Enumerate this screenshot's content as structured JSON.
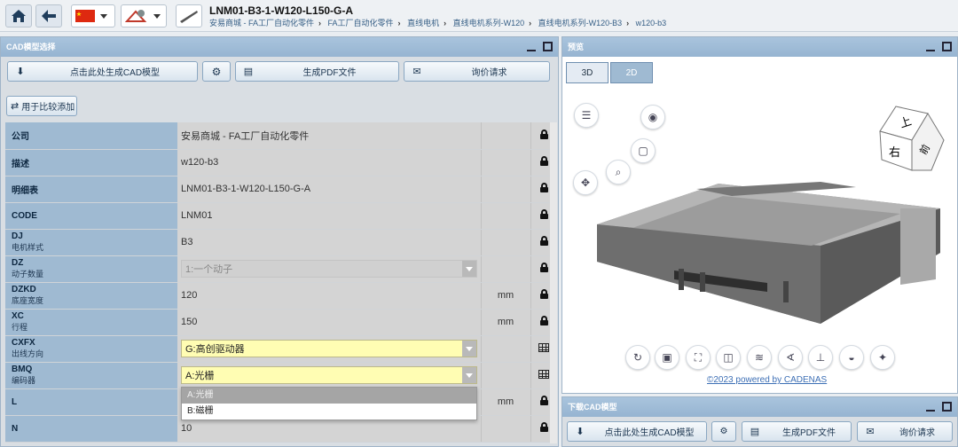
{
  "header": {
    "title": "LNM01-B3-1-W120-L150-G-A",
    "breadcrumbs": [
      "安易商城 - FA工厂自动化零件",
      "FA工厂自动化零件",
      "直线电机",
      "直线电机系列-W120",
      "直线电机系列-W120-B3",
      "w120-b3"
    ]
  },
  "left_panel": {
    "title": "CAD模型选择",
    "buttons": {
      "generate_cad": "点击此处生成CAD模型",
      "generate_pdf": "生成PDF文件",
      "inquiry": "询价请求",
      "compare": "用于比较添加"
    },
    "rows": [
      {
        "key": "公司",
        "sub": "",
        "value": "安易商城 - FA工厂自动化零件",
        "unit": "",
        "kind": "text",
        "icon": "lock"
      },
      {
        "key": "描述",
        "sub": "",
        "value": "w120-b3",
        "unit": "",
        "kind": "text",
        "icon": "lock"
      },
      {
        "key": "明细表",
        "sub": "",
        "value": "LNM01-B3-1-W120-L150-G-A",
        "unit": "",
        "kind": "text",
        "icon": "lock"
      },
      {
        "key": "CODE",
        "sub": "",
        "value": "LNM01",
        "unit": "",
        "kind": "text",
        "icon": "lock"
      },
      {
        "key": "DJ",
        "sub": "电机样式",
        "value": "B3",
        "unit": "",
        "kind": "text",
        "icon": "lock"
      },
      {
        "key": "DZ",
        "sub": "动子数量",
        "value": "1:一个动子",
        "unit": "",
        "kind": "select-disabled",
        "icon": "lock"
      },
      {
        "key": "DZKD",
        "sub": "底座宽度",
        "value": "120",
        "unit": "mm",
        "kind": "text",
        "icon": "lock"
      },
      {
        "key": "XC",
        "sub": "行程",
        "value": "150",
        "unit": "mm",
        "kind": "text",
        "icon": "lock"
      },
      {
        "key": "CXFX",
        "sub": "出线方向",
        "value": "G:高创驱动器",
        "unit": "",
        "kind": "select-yellow",
        "icon": "table"
      },
      {
        "key": "BMQ",
        "sub": "编码器",
        "value": "A:光栅",
        "unit": "",
        "kind": "select-yellow",
        "icon": "table"
      },
      {
        "key": "L",
        "sub": "",
        "value": "",
        "unit": "mm",
        "kind": "text",
        "icon": "lock"
      },
      {
        "key": "N",
        "sub": "",
        "value": "10",
        "unit": "",
        "kind": "text",
        "icon": "lock"
      }
    ],
    "dropdown_options": [
      "A:光栅",
      "B:磁栅"
    ]
  },
  "preview": {
    "title": "预览",
    "toggle_3d": "3D",
    "toggle_2d": "2D",
    "view_cube_front": "右",
    "view_cube_top": "上",
    "view_cube_side": "前",
    "copyright": "©2023 powered by CADENAS"
  },
  "download_panel": {
    "title": "下载CAD模型",
    "generate_cad": "点击此处生成CAD模型",
    "generate_pdf": "生成PDF文件",
    "inquiry": "询价请求"
  },
  "colors": {
    "header_blue": "#9fbad2",
    "highlight_yellow": "#fffdb3",
    "accent": "#365f86"
  }
}
